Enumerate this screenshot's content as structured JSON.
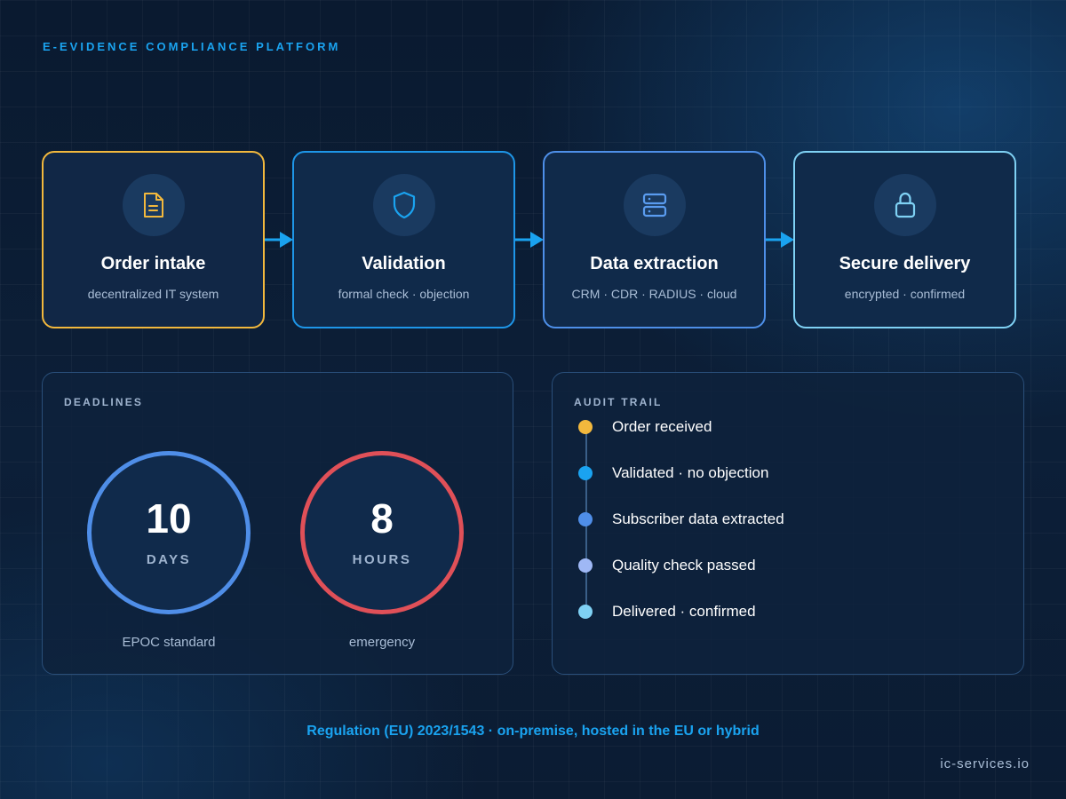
{
  "header": {
    "eyebrow": "E-EVIDENCE COMPLIANCE PLATFORM"
  },
  "steps": [
    {
      "title": "Order intake",
      "subtitle": "decentralized IT system",
      "icon": "document-icon",
      "color": "#f2b83d"
    },
    {
      "title": "Validation",
      "subtitle": "formal check · objection",
      "icon": "shield-icon",
      "color": "#1e96e8"
    },
    {
      "title": "Data extraction",
      "subtitle": "CRM · CDR · RADIUS · cloud",
      "icon": "server-icon",
      "color": "#4e8fe8"
    },
    {
      "title": "Secure delivery",
      "subtitle": "encrypted · confirmed",
      "icon": "lock-icon",
      "color": "#7fd1f4"
    }
  ],
  "deadlines": {
    "title": "DEADLINES",
    "items": [
      {
        "value": "10",
        "unit": "DAYS",
        "caption": "EPOC standard",
        "color": "#4f8ee8"
      },
      {
        "value": "8",
        "unit": "HOURS",
        "caption": "emergency",
        "color": "#e05058"
      }
    ]
  },
  "audit": {
    "title": "AUDIT TRAIL",
    "events": [
      {
        "label": "Order received",
        "color": "#f2b83d"
      },
      {
        "label": "Validated · no objection",
        "color": "#1aa3f0"
      },
      {
        "label": "Subscriber data extracted",
        "color": "#4f8ee8"
      },
      {
        "label": "Quality check passed",
        "color": "#9fb8f5"
      },
      {
        "label": "Delivered · confirmed",
        "color": "#7fd1f4"
      }
    ]
  },
  "footer": {
    "note": "Regulation (EU) 2023/1543 · on-premise, hosted in the EU or hybrid",
    "brand": "ic-services.io"
  }
}
